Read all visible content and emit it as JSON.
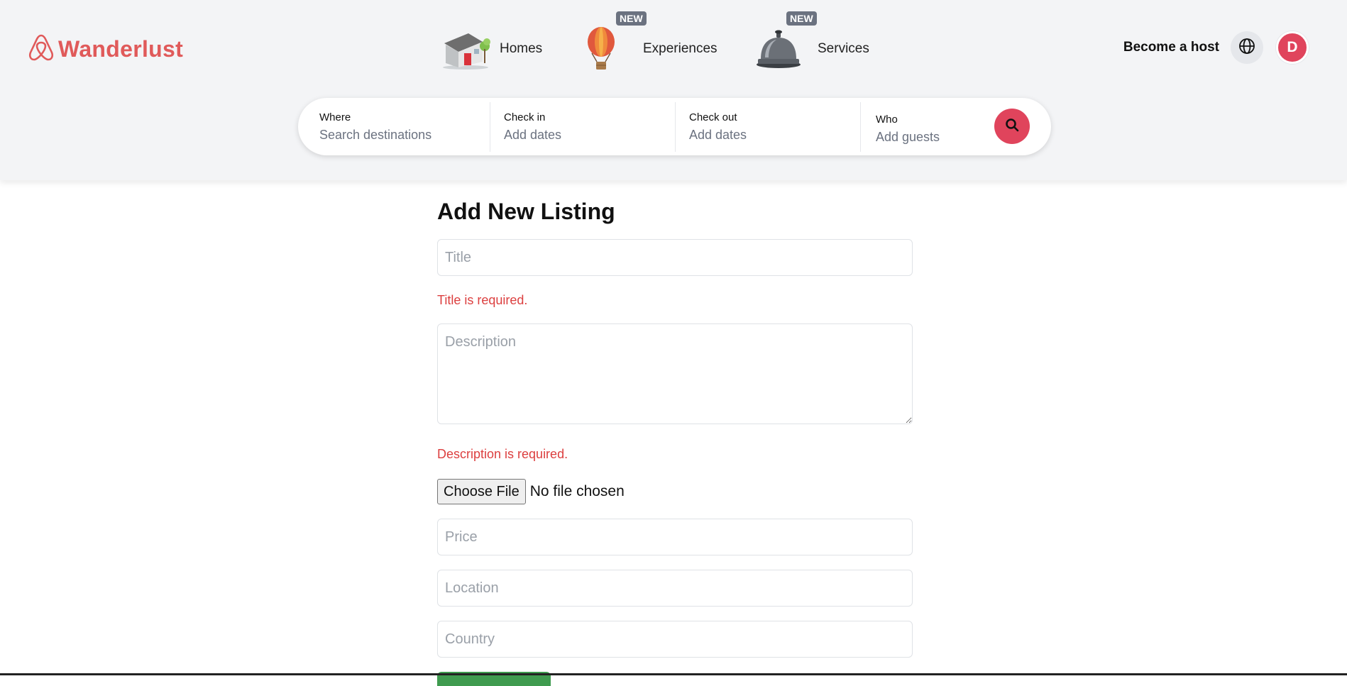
{
  "brand": {
    "name": "Wanderlust",
    "color": "#e05a5a"
  },
  "nav": {
    "items": [
      {
        "label": "Homes",
        "icon": "house-icon",
        "badge": null
      },
      {
        "label": "Experiences",
        "icon": "hot-air-balloon-icon",
        "badge": "NEW"
      },
      {
        "label": "Services",
        "icon": "service-bell-icon",
        "badge": "NEW"
      }
    ]
  },
  "header_actions": {
    "host_label": "Become a host",
    "globe_icon": "globe-icon",
    "avatar_initial": "D"
  },
  "search": {
    "where": {
      "label": "Where",
      "placeholder": "Search destinations"
    },
    "check_in": {
      "label": "Check in",
      "placeholder": "Add dates"
    },
    "check_out": {
      "label": "Check out",
      "placeholder": "Add dates"
    },
    "who": {
      "label": "Who",
      "placeholder": "Add guests"
    },
    "button_icon": "search-icon"
  },
  "form": {
    "title": "Add New Listing",
    "title_placeholder": "Title",
    "title_error": "Title is required.",
    "description_placeholder": "Description",
    "description_error": "Description is required.",
    "file_button": "Choose File",
    "file_status": "No file chosen",
    "price_placeholder": "Price",
    "location_placeholder": "Location",
    "country_placeholder": "Country"
  },
  "colors": {
    "accent": "#e0445c",
    "error": "#dc3f3f",
    "submit": "#3f9b4f",
    "header_bg": "#f3f4f6",
    "badge_bg": "#6b7280"
  }
}
